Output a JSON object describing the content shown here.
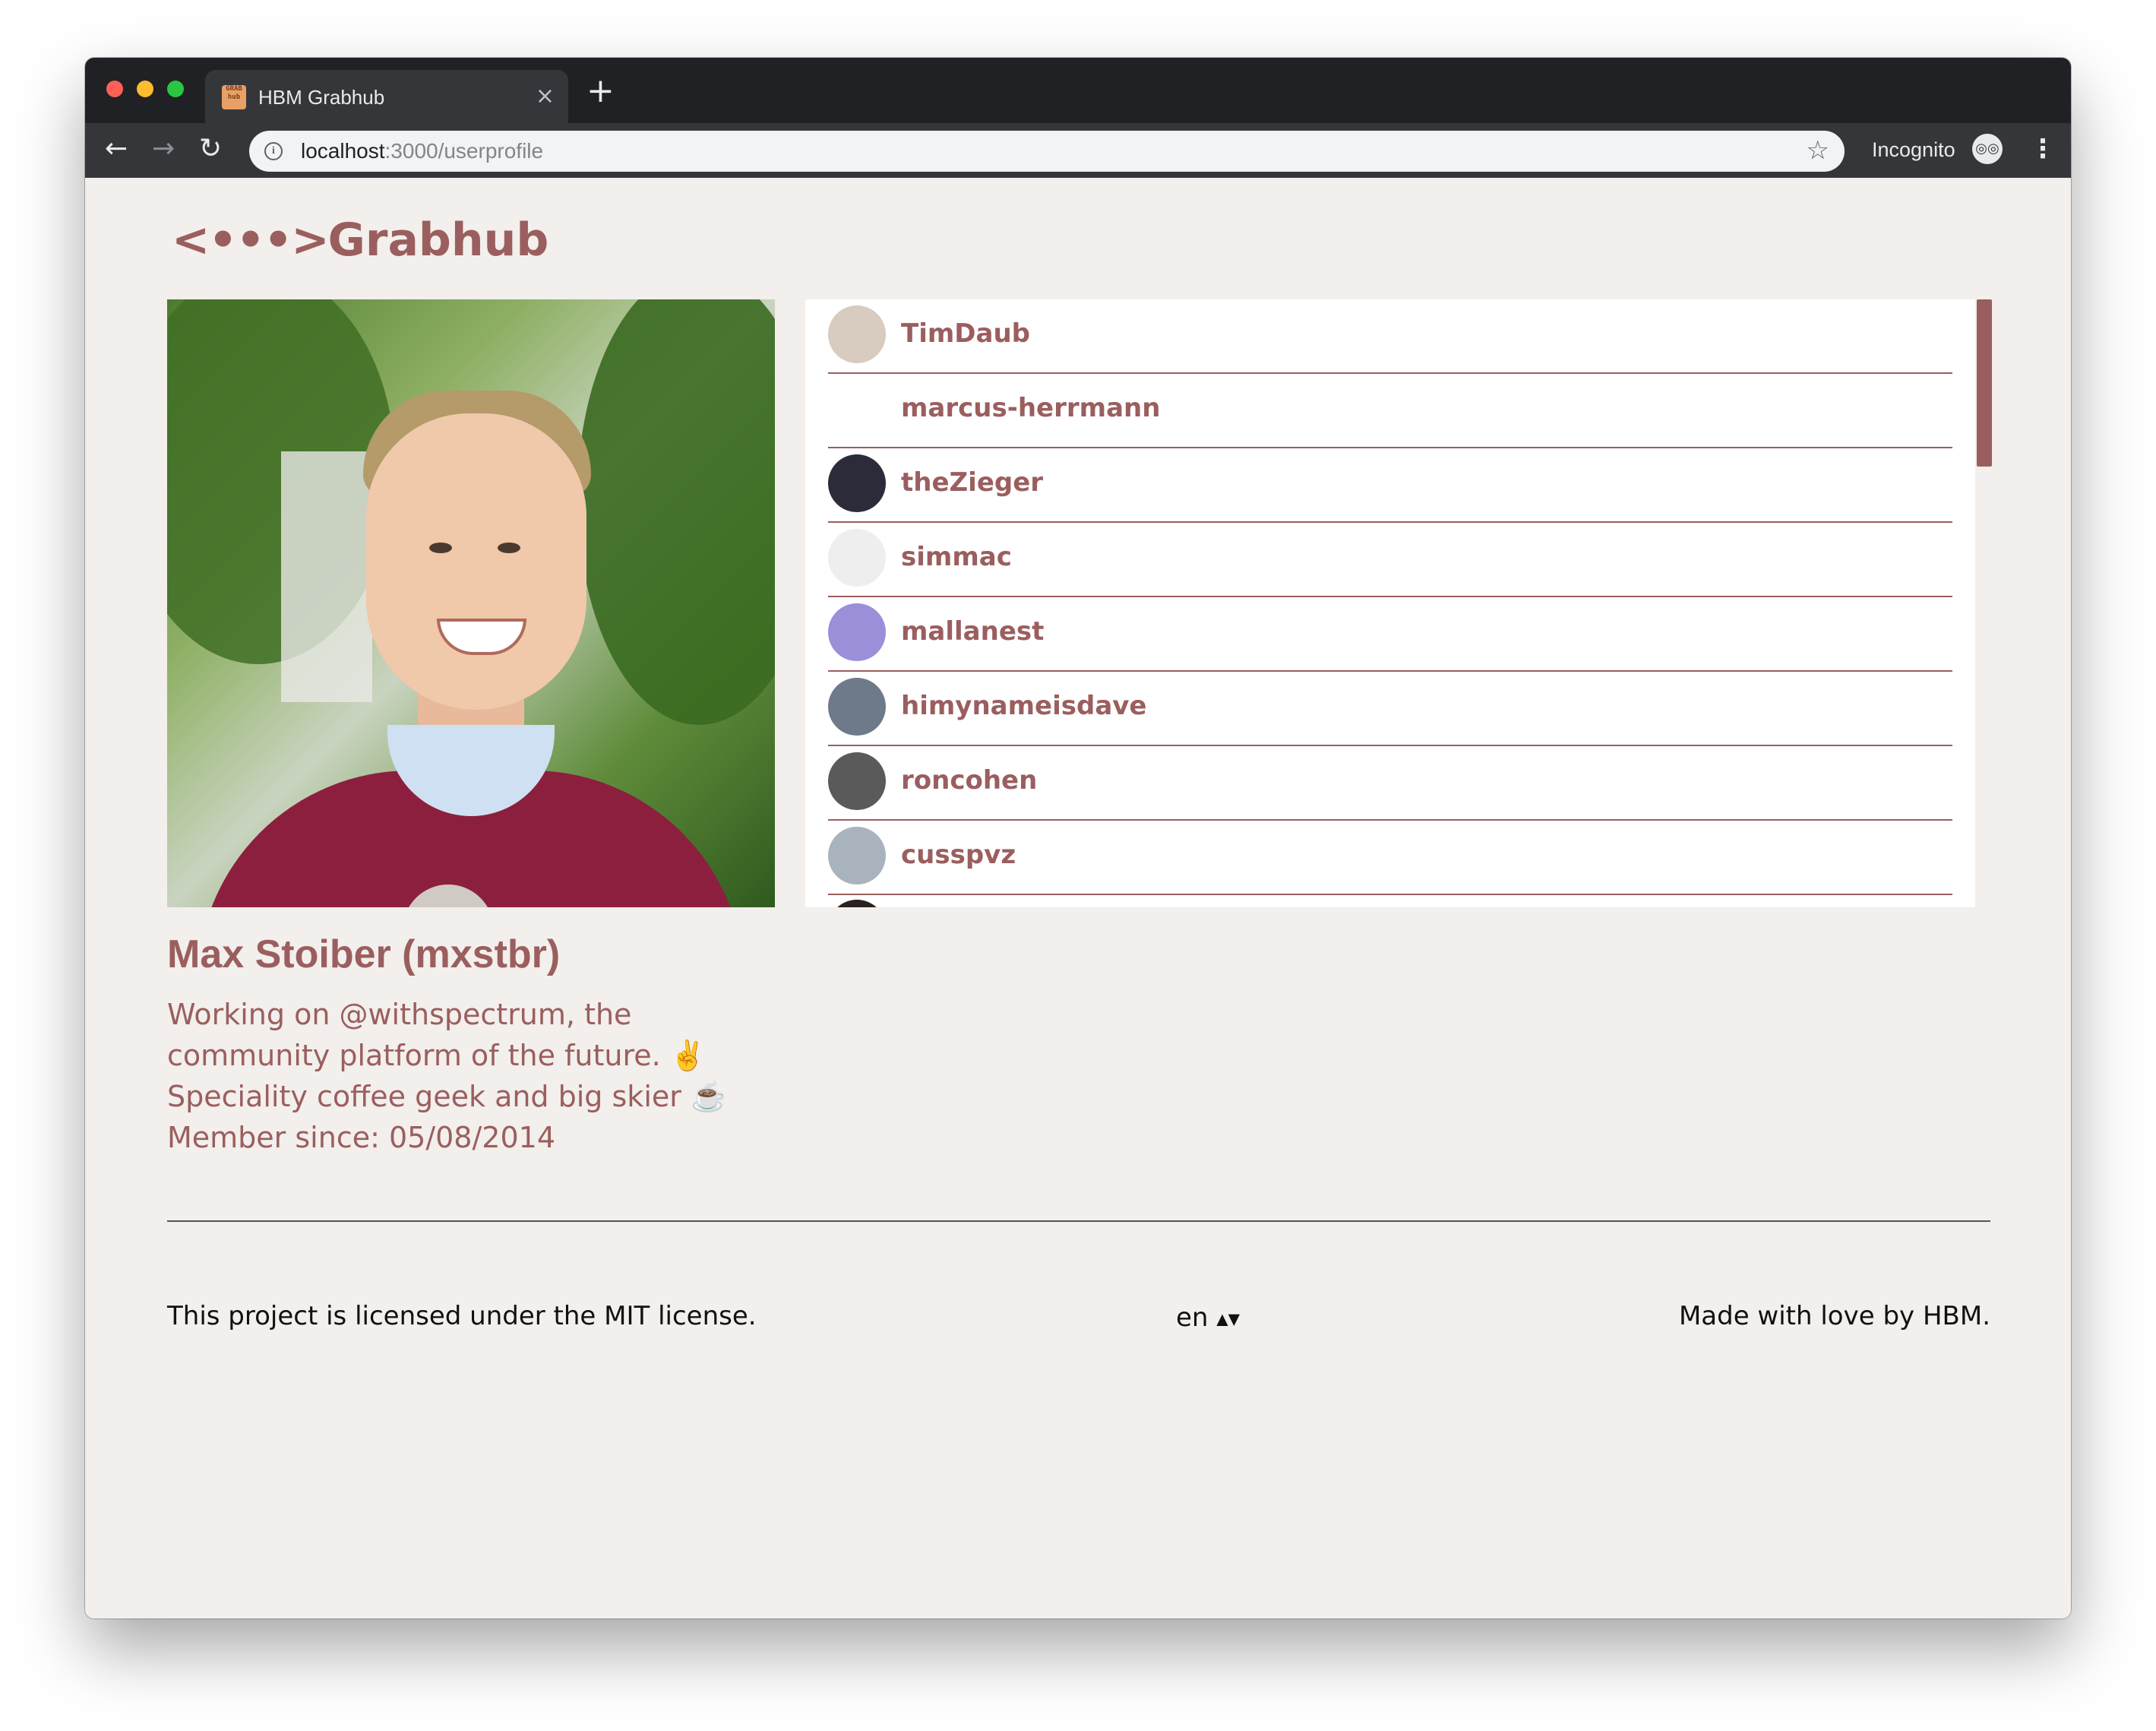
{
  "browser": {
    "tab_title": "HBM Grabhub",
    "favicon_text": "GRAB hub",
    "tab_close_icon": "×",
    "new_tab_icon": "+",
    "url_host": "localhost",
    "url_path": ":3000/userprofile",
    "incognito_label": "Incognito",
    "back_icon": "←",
    "forward_icon": "→",
    "reload_icon": "↻",
    "info_icon": "i",
    "star_icon": "☆",
    "menu_icon": "⋮",
    "incognito_icon": "◎◎"
  },
  "header": {
    "logo_brackets": "<•••>",
    "logo_text": "Grabhub"
  },
  "profile": {
    "name": "Max Stoiber (mxstbr)",
    "bio": "Working on @withspectrum, the community platform of the future. ✌️  Speciality coffee geek and big skier ☕️",
    "member_since": "Member since: 05/08/2014"
  },
  "following": [
    {
      "username": "TimDaub",
      "avatar_color": "#d8cbbf"
    },
    {
      "username": "marcus-herrmann",
      "avatar_color": "#ffffff"
    },
    {
      "username": "theZieger",
      "avatar_color": "#2b2b3a"
    },
    {
      "username": "simmac",
      "avatar_color": "#eeeeee"
    },
    {
      "username": "mallanest",
      "avatar_color": "#9a8fd8"
    },
    {
      "username": "himynameisdave",
      "avatar_color": "#6e7a8a"
    },
    {
      "username": "roncohen",
      "avatar_color": "#5a5a5a"
    },
    {
      "username": "cusspvz",
      "avatar_color": "#a9b3bd"
    }
  ],
  "footer": {
    "license": "This project is licensed under the MIT license.",
    "language": "en",
    "lang_arrows": "▲▼",
    "credit": "Made with love by HBM."
  },
  "colors": {
    "accent": "#9b5e5e",
    "page_bg": "#f2efec",
    "list_bg": "#ffffff"
  }
}
